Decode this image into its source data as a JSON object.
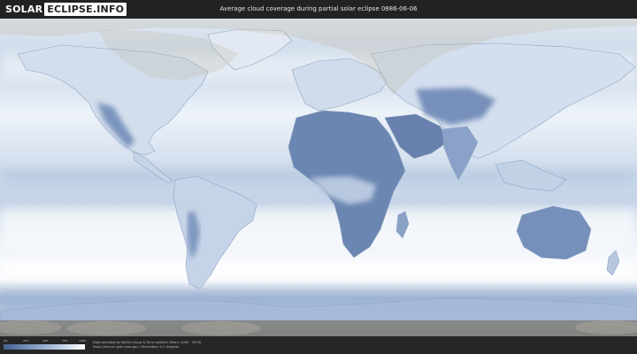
{
  "header": {
    "logo_part1": "SOLAR",
    "logo_part2": "ECLIPSE.INFO",
    "title": "Average cloud coverage during partial solar eclipse 0886-06-06"
  },
  "legend": {
    "ticks": [
      "0%",
      "25%",
      "50%",
      "75%",
      "100%"
    ],
    "colors": [
      "#44618f",
      "#7d98bf",
      "#bccce2",
      "#ffffff"
    ]
  },
  "footer": {
    "credit_line1": "Data provided by NASA's Aqua & Terra satellite (Years: 2000 - 2019)",
    "credit_line2": "https://neo.sci.gsfc.nasa.gov | Resolution: 0.1 degrees"
  },
  "colors": {
    "cloud_white": "#f4f7fb",
    "land_blue": "#6f88b3",
    "ocean_blue": "#b9cbe2",
    "shadow_overlay": "#c8c2b4"
  }
}
